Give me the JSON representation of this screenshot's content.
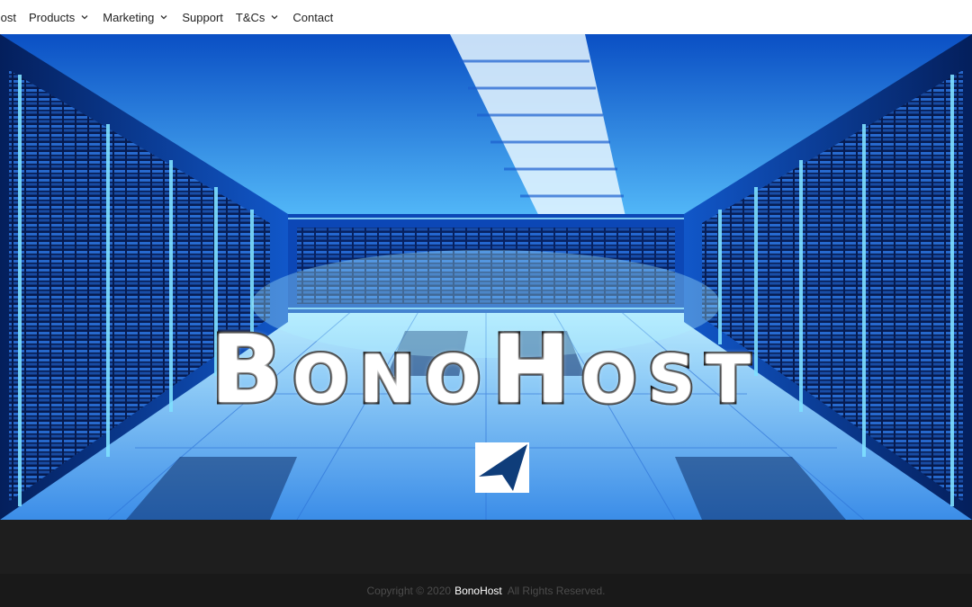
{
  "nav": {
    "brand": "oHost",
    "items": [
      {
        "label": "Products",
        "has_dropdown": true
      },
      {
        "label": "Marketing",
        "has_dropdown": true
      },
      {
        "label": "Support",
        "has_dropdown": false
      },
      {
        "label": "T&Cs",
        "has_dropdown": true
      },
      {
        "label": "Contact",
        "has_dropdown": false
      }
    ]
  },
  "hero": {
    "logo_text": "BonoHost",
    "logo_mark_icon": "arrow-cursor-icon"
  },
  "footer": {
    "copyright_prefix": "Copyright © 2020",
    "brand": "BonoHost",
    "rights": "All Rights Reserved."
  },
  "colors": {
    "nav_bg": "#ffffff",
    "hero_accent": "#1e8cff",
    "logo_mark_blue": "#0f3d7a",
    "footer_band": "#1e1e1e",
    "footer_bar": "#191919"
  }
}
